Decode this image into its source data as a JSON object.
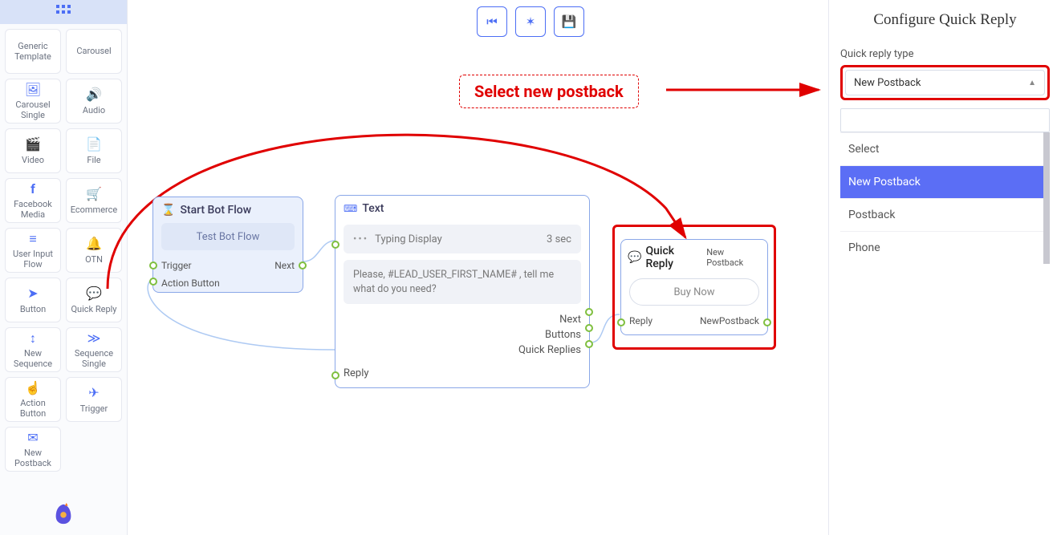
{
  "sidebar": {
    "tools": [
      {
        "label": "Generic Template",
        "icon": "▭"
      },
      {
        "label": "Carousel",
        "icon": "▭"
      },
      {
        "label": "Carousel Single",
        "icon": "🖼"
      },
      {
        "label": "Audio",
        "icon": "🔊"
      },
      {
        "label": "Video",
        "icon": "🎬"
      },
      {
        "label": "File",
        "icon": "📄"
      },
      {
        "label": "Facebook Media",
        "icon": "f"
      },
      {
        "label": "Ecommerce",
        "icon": "🛒"
      },
      {
        "label": "User Input Flow",
        "icon": "≡"
      },
      {
        "label": "OTN",
        "icon": "🔔"
      },
      {
        "label": "Button",
        "icon": "➤"
      },
      {
        "label": "Quick Reply",
        "icon": "💬"
      },
      {
        "label": "New Sequence",
        "icon": "↕"
      },
      {
        "label": "Sequence Single",
        "icon": "≫"
      },
      {
        "label": "Action Button",
        "icon": "☝"
      },
      {
        "label": "Trigger",
        "icon": "✈"
      },
      {
        "label": "New Postback",
        "icon": "✉"
      }
    ]
  },
  "toolbar": {
    "back": "⏮",
    "compress": "✶",
    "save": "💾"
  },
  "annotation": {
    "text": "Select new postback"
  },
  "nodes": {
    "start": {
      "title": "Start Bot Flow",
      "test_label": "Test Bot Flow",
      "out_trigger": "Trigger",
      "out_next": "Next",
      "out_action": "Action Button"
    },
    "text": {
      "title": "Text",
      "typing_label": "Typing Display",
      "typing_value": "3 sec",
      "message": "Please, #LEAD_USER_FIRST_NAME# , tell me what do you need?",
      "out_next": "Next",
      "out_buttons": "Buttons",
      "out_quick": "Quick Replies",
      "out_reply": "Reply"
    },
    "qr": {
      "title": "Quick Reply",
      "badge": "New Postback",
      "button_label": "Buy Now",
      "out_reply": "Reply",
      "out_newpb": "NewPostback"
    }
  },
  "right": {
    "title": "Configure Quick Reply",
    "type_label": "Quick reply type",
    "selected": "New Postback",
    "options": [
      "Select",
      "New Postback",
      "Postback",
      "Phone"
    ]
  }
}
